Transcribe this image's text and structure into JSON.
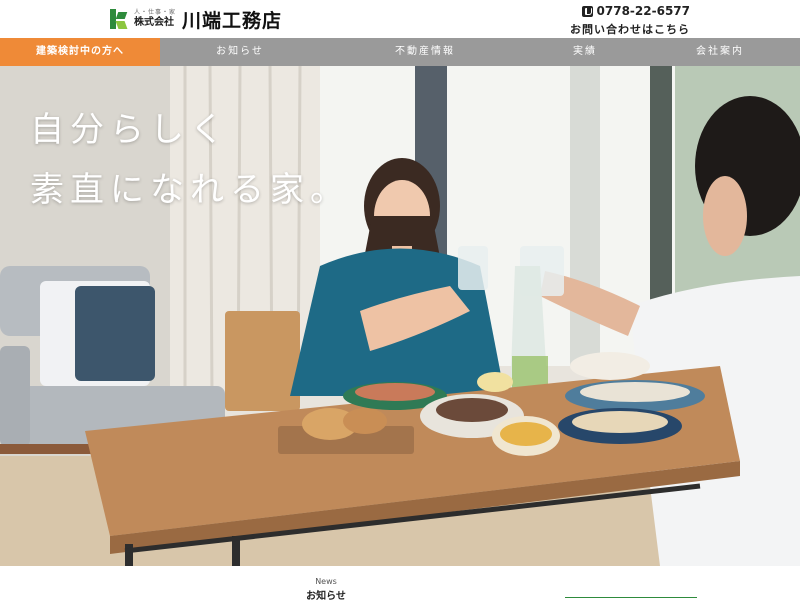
{
  "header": {
    "logo_tagline": "人・仕事・家",
    "logo_corp": "株式会社",
    "logo_name": "川端工務店",
    "phone": "0778-22-6577",
    "phone_icon": "phone-icon",
    "contact_link": "お問い合わせはこちら"
  },
  "nav": {
    "items": [
      {
        "label": "建築検討中の方へ",
        "highlight": true
      },
      {
        "label": "お知らせ"
      },
      {
        "label": "不動産情報"
      },
      {
        "label": "実績"
      },
      {
        "label": "会社案内"
      }
    ]
  },
  "hero": {
    "lines": [
      "自分らしく",
      "素直になれる家。"
    ]
  },
  "news": {
    "heading_en": "News",
    "heading_ja": "お知らせ"
  },
  "colors": {
    "accent": "#ef8a37",
    "nav_bg": "#9a9a9a",
    "brand_green": "#2e8b3c"
  }
}
